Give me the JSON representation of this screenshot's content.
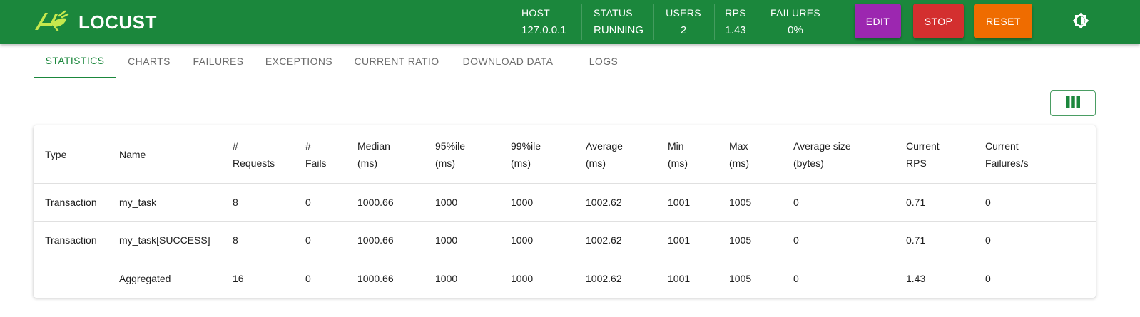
{
  "brand": {
    "name": "LOCUST"
  },
  "stats": [
    {
      "label": "HOST",
      "value": "127.0.0.1"
    },
    {
      "label": "STATUS",
      "value": "RUNNING"
    },
    {
      "label": "USERS",
      "value": "2"
    },
    {
      "label": "RPS",
      "value": "1.43"
    },
    {
      "label": "FAILURES",
      "value": "0%"
    }
  ],
  "actions": {
    "edit": "EDIT",
    "stop": "STOP",
    "reset": "RESET"
  },
  "colors": {
    "header_bg": "#1b873c",
    "edit": "#9c27b0",
    "stop": "#d32f2f",
    "reset": "#ef6c00",
    "accent": "#1b873c"
  },
  "icons": {
    "theme_toggle": "brightness-icon",
    "columns": "view-column-icon",
    "logo": "locust-logo-icon"
  },
  "tabs": [
    "STATISTICS",
    "CHARTS",
    "FAILURES",
    "EXCEPTIONS",
    "CURRENT RATIO",
    "DOWNLOAD DATA",
    "LOGS"
  ],
  "active_tab": "STATISTICS",
  "table": {
    "headers": [
      "Type",
      "Name",
      "#\nRequests",
      "#\nFails",
      "Median\n(ms)",
      "95%ile\n(ms)",
      "99%ile\n(ms)",
      "Average\n(ms)",
      "Min\n(ms)",
      "Max\n(ms)",
      "Average size\n(bytes)",
      "Current\nRPS",
      "Current\nFailures/s"
    ],
    "rows": [
      [
        "Transaction",
        "my_task",
        "8",
        "0",
        "1000.66",
        "1000",
        "1000",
        "1002.62",
        "1001",
        "1005",
        "0",
        "0.71",
        "0"
      ],
      [
        "Transaction",
        "my_task[SUCCESS]",
        "8",
        "0",
        "1000.66",
        "1000",
        "1000",
        "1002.62",
        "1001",
        "1005",
        "0",
        "0.71",
        "0"
      ],
      [
        "",
        "Aggregated",
        "16",
        "0",
        "1000.66",
        "1000",
        "1000",
        "1002.62",
        "1001",
        "1005",
        "0",
        "1.43",
        "0"
      ]
    ]
  }
}
